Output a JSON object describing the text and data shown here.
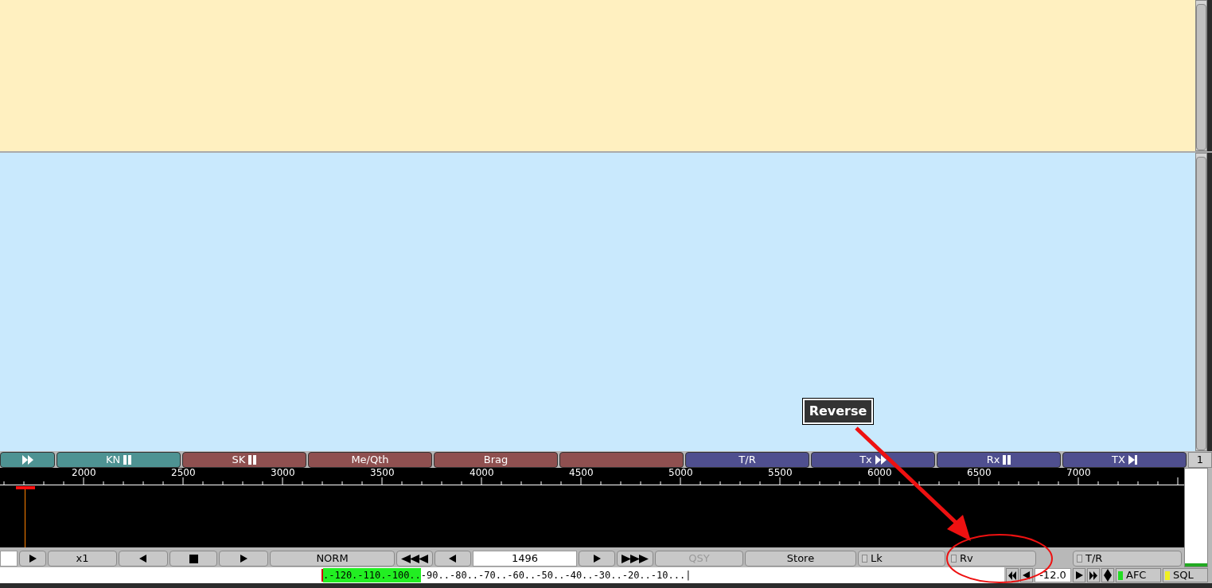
{
  "macros": [
    {
      "color": "#4e9393"
    },
    {
      "label": "KN",
      "color": "#4e9393"
    },
    {
      "label": "SK",
      "color": "#8f5050"
    },
    {
      "label": "Me/Qth",
      "color": "#8f5050"
    },
    {
      "label": "Brag",
      "color": "#8f5050"
    },
    {
      "color": "#8f5050"
    },
    {
      "label": "T/R",
      "color": "#4f4f8f"
    },
    {
      "label": "Tx",
      "color": "#4f4f8f"
    },
    {
      "label": "Rx",
      "color": "#4f4f8f"
    },
    {
      "label": "TX",
      "color": "#4f4f8f"
    }
  ],
  "macro_set": "1",
  "ruler": {
    "labels": [
      "2000",
      "2500",
      "3000",
      "3500",
      "4000",
      "4500",
      "5000",
      "5500",
      "6000",
      "6500",
      "7000"
    ]
  },
  "controls": [
    {
      "kind": "field"
    },
    {
      "kind": "button"
    },
    {
      "kind": "button",
      "label": "x1"
    },
    {
      "kind": "button"
    },
    {
      "kind": "button"
    },
    {
      "kind": "button"
    },
    {
      "kind": "button",
      "label": "NORM"
    },
    {
      "kind": "button"
    },
    {
      "kind": "button"
    },
    {
      "kind": "field",
      "value": "1496"
    },
    {
      "kind": "button"
    },
    {
      "kind": "button"
    },
    {
      "kind": "button",
      "label": "QSY",
      "disabled": true
    },
    {
      "kind": "button",
      "label": "Store",
      "disabled": false
    },
    {
      "kind": "check",
      "label": "Lk",
      "checked": false
    },
    {
      "kind": "check",
      "label": "Rv",
      "checked": false
    },
    {
      "kind": "check",
      "label": "T/R",
      "checked": false
    }
  ],
  "smeter": {
    "lit": ".-120.-110.-100..",
    "rest": "-90..-80..-70..-60..-50..-40..-30..-20..-10...|"
  },
  "status": [
    {
      "kind": "button"
    },
    {
      "kind": "button"
    },
    {
      "kind": "field",
      "value": "-12.0"
    },
    {
      "kind": "button"
    },
    {
      "kind": "button"
    },
    {
      "kind": "button"
    },
    {
      "kind": "toggle",
      "label": "AFC",
      "color": "#22dd22"
    },
    {
      "kind": "toggle",
      "label": "SQL",
      "color": "#f0f020"
    }
  ],
  "callout": {
    "label": "Reverse"
  }
}
